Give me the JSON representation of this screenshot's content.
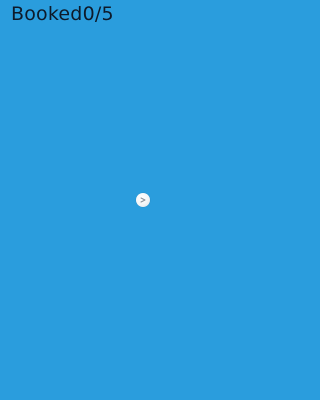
{
  "hud": {
    "booked_label": "Booked",
    "booked_count": "0/5"
  },
  "colors": {
    "background": "#2a9ddd",
    "text": "#0d1a2a",
    "ball": "#f3f5f7"
  },
  "icons": {
    "player": "arrow-ball-icon"
  }
}
